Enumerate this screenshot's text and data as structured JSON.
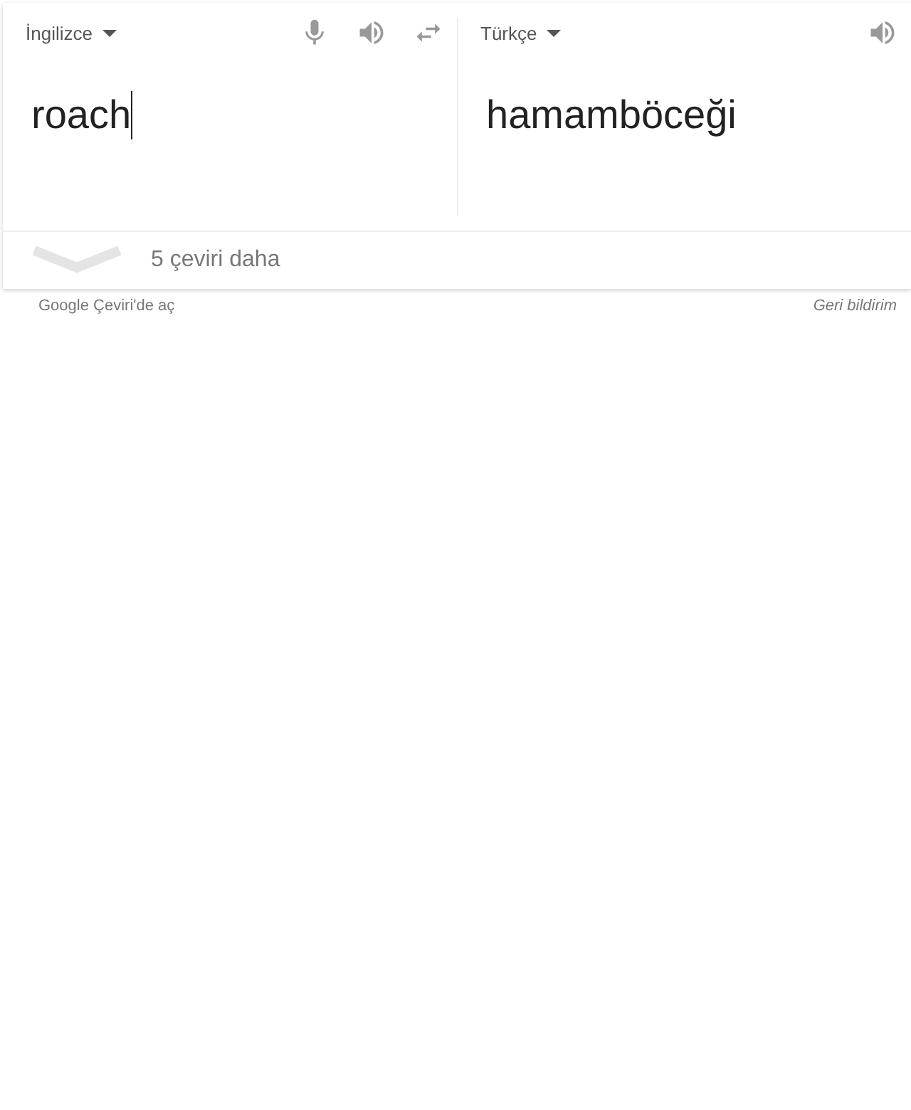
{
  "source": {
    "language": "İngilizce",
    "text": "roach"
  },
  "target": {
    "language": "Türkçe",
    "text": "hamamböceği"
  },
  "more": {
    "label": "5 çeviri daha",
    "expanded": false
  },
  "footer": {
    "open_link": "Google Çeviri'de aç",
    "feedback_link": "Geri bildirim"
  }
}
